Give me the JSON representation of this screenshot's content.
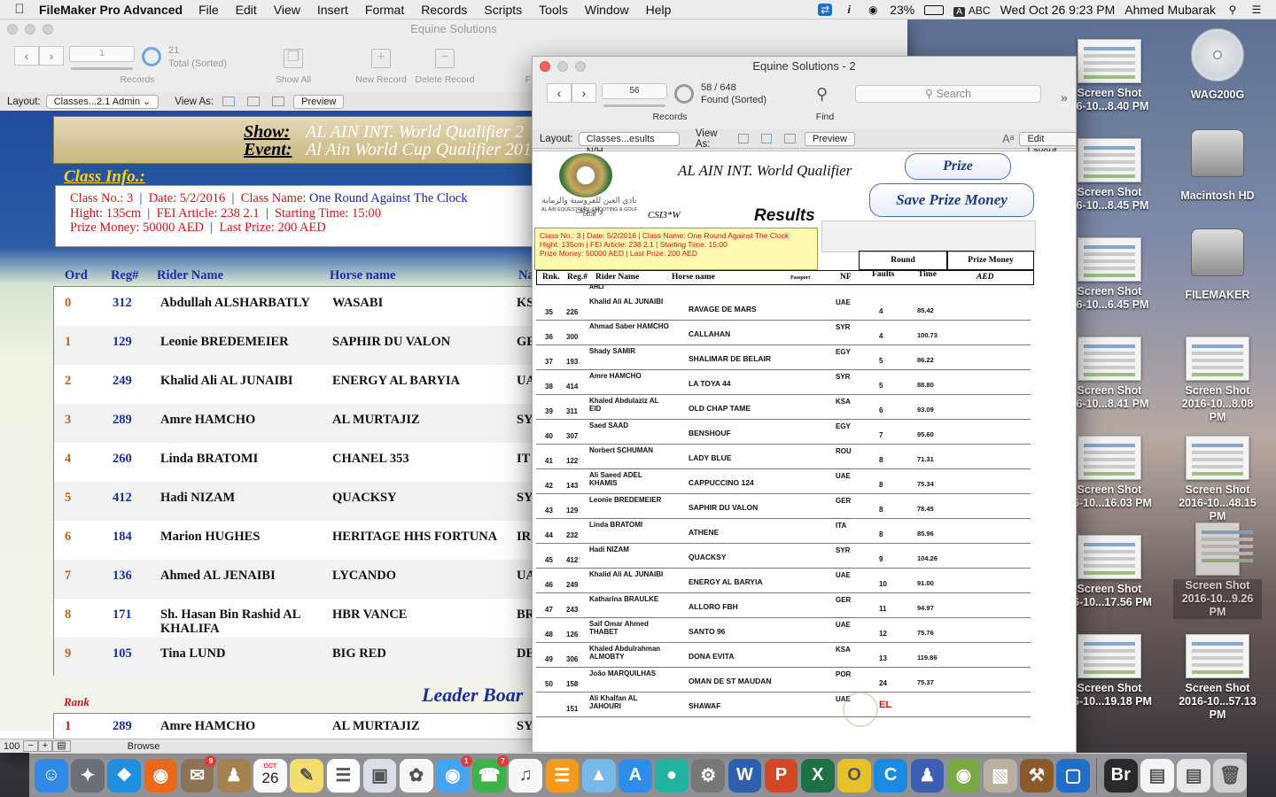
{
  "menubar": {
    "app_name": "FileMaker Pro Advanced",
    "menus": [
      "File",
      "Edit",
      "View",
      "Insert",
      "Format",
      "Records",
      "Scripts",
      "Tools",
      "Window",
      "Help"
    ],
    "battery": "23%",
    "input_source": "ABC",
    "input_source_badge": "A",
    "clock": "Wed Oct 26  9:23 PM",
    "user": "Ahmed Mubarak"
  },
  "desktop": {
    "icons": [
      {
        "name": "Screen Shot",
        "sub": "16-10...8.40 PM"
      },
      {
        "name": "WAG200G",
        "sub": ""
      },
      {
        "name": "Screen Shot",
        "sub": "16-10...8.45 PM"
      },
      {
        "name": "Macintosh HD",
        "sub": ""
      },
      {
        "name": "Screen Shot",
        "sub": "16-10...6.45 PM"
      },
      {
        "name": "FILEMAKER",
        "sub": ""
      },
      {
        "name": "Screen Shot",
        "sub": "16-10...8.41 PM"
      },
      {
        "name": "Screen Shot",
        "sub": "2016-10...8.08 PM"
      },
      {
        "name": "Screen Shot",
        "sub": "16-10...16.03 PM"
      },
      {
        "name": "Screen Shot",
        "sub": "2016-10...48.15 PM"
      },
      {
        "name": "Screen Shot",
        "sub": "16-10...17.56 PM"
      },
      {
        "name": "Screen Shot",
        "sub": "2016-10...9.26 PM"
      },
      {
        "name": "Screen Shot",
        "sub": "16-10...19.18 PM"
      },
      {
        "name": "Screen Shot",
        "sub": "2016-10...57.13 PM"
      }
    ]
  },
  "win1": {
    "title": "Equine Solutions",
    "record_value": "1",
    "total": "21",
    "total_label": "Total (Sorted)",
    "records_label": "Records",
    "show_all": "Show All",
    "new_record": "New Record",
    "delete_record": "Delete Record",
    "find_label": "F",
    "layout_label": "Layout:",
    "layout_value": "Classes...2.1 Admin",
    "view_as": "View As:",
    "preview": "Preview",
    "show_label": "Show:",
    "show_value": "AL AIN INT. World Qualifier  2",
    "event_label": "Event:",
    "event_value": "Al Ain World Cup Qualifier 201",
    "class_info": "Class Info.:",
    "info": {
      "classno_l": "Class No.:",
      "classno": "3",
      "date_l": "Date:",
      "date": "5/2/2016",
      "classname_l": "Class Name:",
      "classname": "One Round Against The Clock",
      "height_l": "Hight:",
      "height": "135cm",
      "fei_l": "FEI Article:",
      "fei": "238 2.1",
      "start_l": "Starting Time:",
      "start": "15:00",
      "prize_l": "Prize Money:",
      "prize": "50000 AED",
      "last_l": "Last Prize:",
      "last": "200 AED"
    },
    "headers": {
      "ord": "Ord",
      "reg": "Reg#",
      "rider": "Rider Name",
      "horse": "Horse  name",
      "nat": "Na"
    },
    "rows": [
      {
        "ord": "0",
        "reg": "312",
        "rider": "Abdullah ALSHARBATLY",
        "horse": "WASABI",
        "nat": "KS"
      },
      {
        "ord": "1",
        "reg": "129",
        "rider": "Leonie BREDEMEIER",
        "horse": "SAPHIR DU VALON",
        "nat": "GE"
      },
      {
        "ord": "2",
        "reg": "249",
        "rider": "Khalid Ali AL JUNAIBI",
        "horse": "ENERGY AL BARYIA",
        "nat": "UA"
      },
      {
        "ord": "3",
        "reg": "289",
        "rider": "Amre HAMCHO",
        "horse": "AL MURTAJIZ",
        "nat": "SY"
      },
      {
        "ord": "4",
        "reg": "260",
        "rider": "Linda BRATOMI",
        "horse": "CHANEL 353",
        "nat": "IT"
      },
      {
        "ord": "5",
        "reg": "412",
        "rider": "Hadi NIZAM",
        "horse": "QUACKSY",
        "nat": "SY"
      },
      {
        "ord": "6",
        "reg": "184",
        "rider": "Marion HUGHES",
        "horse": "HERITAGE HHS FORTUNA",
        "nat": "IR"
      },
      {
        "ord": "7",
        "reg": "136",
        "rider": "Ahmed AL JENAIBI",
        "horse": "LYCANDO",
        "nat": "UA"
      },
      {
        "ord": "8",
        "reg": "171",
        "rider": "Sh. Hasan Bin Rashid AL KHALIFA",
        "horse": "HBR VANCE",
        "nat": "BR"
      },
      {
        "ord": "9",
        "reg": "105",
        "rider": "Tina LUND",
        "horse": "BIG RED",
        "nat": "DE"
      }
    ],
    "leader_board": "Leader Boar",
    "rank_label": "Rank",
    "leader_row": {
      "ord": "1",
      "reg": "289",
      "rider": "Amre HAMCHO",
      "horse": "AL MURTAJIZ",
      "nat": "SY"
    },
    "zoom": "100",
    "mode": "Browse"
  },
  "win2": {
    "title": "Equine Solutions - 2",
    "record_value": "56",
    "found": "58 / 648",
    "found_label": "Found (Sorted)",
    "records_label": "Records",
    "find_label": "Find",
    "search_placeholder": "Search",
    "layout_label": "Layout:",
    "layout_value": "Classes...esults N/H",
    "view_as": "View As:",
    "preview": "Preview",
    "edit_layout": "Edit Layout",
    "club_name_ar": "نادي العين للفروسية والرماية والجولف",
    "club_name": "AL AIN EQUESTRIAN, SHOOTING & GOLF CLUB",
    "show_title": "AL AIN INT. World Qualifier",
    "prize_btn": "Prize",
    "save_prize_btn": "Save Prize Money",
    "results": "Results",
    "csi": "CSI3*W",
    "info_line1": "Class No.: 3  |  Date: 5/2/2016  |  Class Name: One Round Against The Clock",
    "info_line2": "Hight: 135cm  |  FEI Article: 238 2.1  |  Starting Time: 15:00",
    "info_line3": "Prize Money: 50000 AED  |  Last Prize: 200 AED",
    "round": "Round",
    "prize_money": "Prize  Money",
    "aed": "AED",
    "headers": {
      "rnk": "Rnk.",
      "reg": "Reg.#",
      "rider": "Rider Name",
      "horse": "Horse  name",
      "passport": "Passport",
      "nf": "NF",
      "faults": "Faults",
      "time": "Time"
    },
    "cut_row_name": "AHLI",
    "rows": [
      {
        "rnk": "35",
        "reg": "226",
        "rider": "Khalid Ali AL JUNAIBI",
        "horse": "RAVAGE DE MARS",
        "nf": "UAE",
        "faults": "4",
        "time": "85.42"
      },
      {
        "rnk": "36",
        "reg": "300",
        "rider": "Ahmad Saber HAMCHO",
        "horse": "CALLAHAN",
        "nf": "SYR",
        "faults": "4",
        "time": "100.73"
      },
      {
        "rnk": "37",
        "reg": "193",
        "rider": "Shady SAMIR",
        "horse": "SHALIMAR DE BELAIR",
        "nf": "EGY",
        "faults": "5",
        "time": "86.22"
      },
      {
        "rnk": "38",
        "reg": "414",
        "rider": "Amre HAMCHO",
        "horse": "LA TOYA 44",
        "nf": "SYR",
        "faults": "5",
        "time": "88.80"
      },
      {
        "rnk": "39",
        "reg": "311",
        "rider": "Khaled Abdulaziz AL EID",
        "horse": "OLD CHAP TAME",
        "nf": "KSA",
        "faults": "6",
        "time": "93.09"
      },
      {
        "rnk": "40",
        "reg": "307",
        "rider": "Saed SAAD",
        "horse": "BENSHOUF",
        "nf": "EGY",
        "faults": "7",
        "time": "95.60"
      },
      {
        "rnk": "41",
        "reg": "122",
        "rider": "Norbert SCHUMAN",
        "horse": "LADY BLUE",
        "nf": "ROU",
        "faults": "8",
        "time": "71.31"
      },
      {
        "rnk": "42",
        "reg": "143",
        "rider": "Ali Saeed ADEL KHAMIS",
        "horse": "CAPPUCCINO 124",
        "nf": "UAE",
        "faults": "8",
        "time": "75.34"
      },
      {
        "rnk": "43",
        "reg": "129",
        "rider": "Leonie BREDEMEIER",
        "horse": "SAPHIR DU VALON",
        "nf": "GER",
        "faults": "8",
        "time": "78.45"
      },
      {
        "rnk": "44",
        "reg": "232",
        "rider": "Linda BRATOMI",
        "horse": "ATHENE",
        "nf": "ITA",
        "faults": "8",
        "time": "85.96"
      },
      {
        "rnk": "45",
        "reg": "412",
        "rider": "Hadi NIZAM",
        "horse": "QUACKSY",
        "nf": "SYR",
        "faults": "9",
        "time": "104.26"
      },
      {
        "rnk": "46",
        "reg": "249",
        "rider": "Khalid Ali AL JUNAIBI",
        "horse": "ENERGY AL BARYIA",
        "nf": "UAE",
        "faults": "10",
        "time": "91.00"
      },
      {
        "rnk": "47",
        "reg": "243",
        "rider": "Katharina BRAULKE",
        "horse": "ALLORO FBH",
        "nf": "GER",
        "faults": "11",
        "time": "94.97"
      },
      {
        "rnk": "48",
        "reg": "126",
        "rider": "Saif Omar Ahmed THABET",
        "horse": "SANTO 96",
        "nf": "UAE",
        "faults": "12",
        "time": "75.76"
      },
      {
        "rnk": "49",
        "reg": "306",
        "rider": "Khaled Abdulrahman ALMOBTY",
        "horse": "DONA EVITA",
        "nf": "KSA",
        "faults": "13",
        "time": "119.86"
      },
      {
        "rnk": "50",
        "reg": "158",
        "rider": "João MARQUILHAS",
        "horse": "OMAN DE ST MAUDAN",
        "nf": "POR",
        "faults": "24",
        "time": "75.37"
      },
      {
        "rnk": "",
        "reg": "151",
        "rider": "Ali Khalfan AL JAHOURI",
        "horse": "SHAWAF",
        "nf": "UAE",
        "faults": "EL",
        "time": ""
      }
    ]
  },
  "dock": {
    "calendar_month": "OCT",
    "calendar_day": "26",
    "apps": [
      "Finder",
      "Launchpad",
      "Safari",
      "Firefox",
      "Mail",
      "Contacts",
      "Calendar",
      "Notes",
      "Reminders",
      "Preview",
      "Photos",
      "Messages",
      "FaceTime",
      "iTunes",
      "iBooks",
      "Maps",
      "App Store",
      "Teal",
      "System Preferences",
      "Word",
      "PowerPoint",
      "Excel",
      "Outlook",
      "C",
      "Team",
      "Network",
      "Photo",
      "Toolbox",
      "Screen",
      "Bridge",
      "Doc",
      "Screens",
      "Trash"
    ],
    "badges": {
      "mail": "9",
      "messages": "1",
      "facetime": "7"
    }
  }
}
